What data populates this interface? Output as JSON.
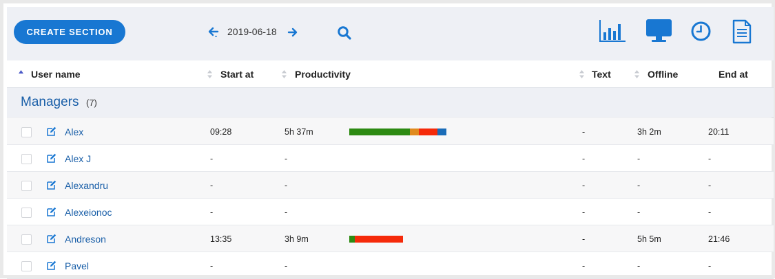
{
  "toolbar": {
    "create_label": "CREATE SECTION",
    "date": "2019-06-18"
  },
  "columns": {
    "user_name": "User name",
    "start_at": "Start at",
    "productivity": "Productivity",
    "text": "Text",
    "offline": "Offline",
    "end_at": "End at"
  },
  "group": {
    "name": "Managers",
    "count": "(7)"
  },
  "colors": {
    "accent": "#1877d2",
    "productive": "#2d8a12",
    "neutral": "#e08a1e",
    "unproductive": "#f52a0a",
    "other": "#1a6cb8"
  },
  "rows": [
    {
      "name": "Alex",
      "start": "09:28",
      "productivity": "5h 37m",
      "text": "-",
      "offline": "3h 2m",
      "end": "20:11",
      "bar": [
        {
          "value": 88,
          "color": "#2d8a12"
        },
        {
          "value": 13,
          "color": "#e08a1e"
        },
        {
          "value": 27,
          "color": "#f52a0a"
        },
        {
          "value": 13,
          "color": "#1a6cb8"
        }
      ]
    },
    {
      "name": "Alex J",
      "start": "-",
      "productivity": "-",
      "text": "-",
      "offline": "-",
      "end": "-",
      "bar": []
    },
    {
      "name": "Alexandru",
      "start": "-",
      "productivity": "-",
      "text": "-",
      "offline": "-",
      "end": "-",
      "bar": []
    },
    {
      "name": "Alexeionoc",
      "start": "-",
      "productivity": "-",
      "text": "-",
      "offline": "-",
      "end": "-",
      "bar": []
    },
    {
      "name": "Andreson",
      "start": "13:35",
      "productivity": "3h 9m",
      "text": "-",
      "offline": "5h 5m",
      "end": "21:46",
      "bar": [
        {
          "value": 8,
          "color": "#2d8a12"
        },
        {
          "value": 70,
          "color": "#f52a0a"
        }
      ]
    },
    {
      "name": "Pavel",
      "start": "-",
      "productivity": "-",
      "text": "-",
      "offline": "-",
      "end": "-",
      "bar": []
    }
  ]
}
